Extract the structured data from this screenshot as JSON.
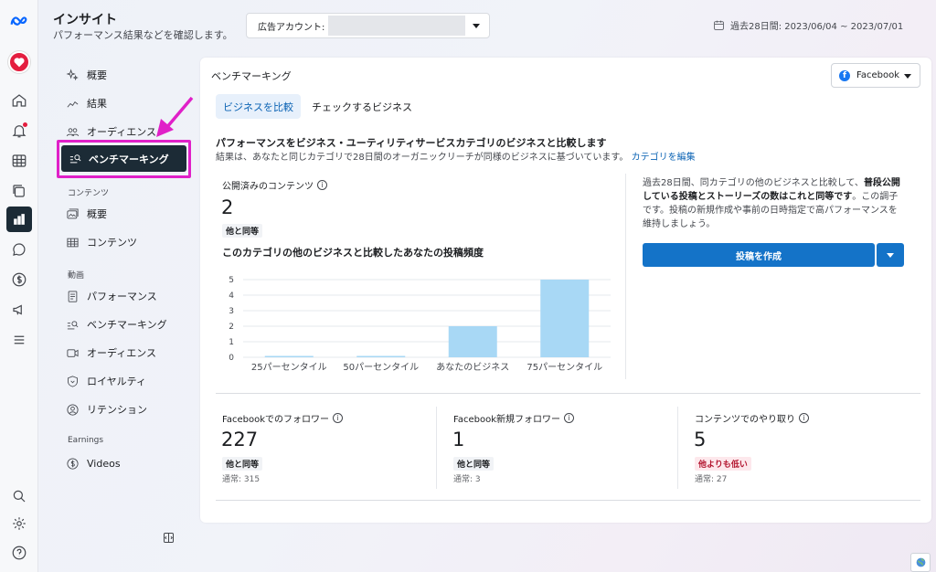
{
  "header": {
    "title": "インサイト",
    "subtitle": "パフォーマンス結果などを確認します。",
    "account_label": "広告アカウント:",
    "date_range": "過去28日間: 2023/06/04 ~ 2023/07/01"
  },
  "sidebar": {
    "items_top": [
      {
        "label": "概要",
        "icon": "sparkle-icon"
      },
      {
        "label": "結果",
        "icon": "trend-icon"
      },
      {
        "label": "オーディエンス",
        "icon": "people-icon"
      }
    ],
    "active": {
      "label": "ベンチマーキング",
      "icon": "benchmark-icon"
    },
    "section_contents": "コンテンツ",
    "items_contents": [
      {
        "label": "概要",
        "icon": "image-icon"
      },
      {
        "label": "コンテンツ",
        "icon": "table-icon"
      }
    ],
    "section_video": "動画",
    "items_video": [
      {
        "label": "パフォーマンス",
        "icon": "document-icon"
      },
      {
        "label": "ベンチマーキング",
        "icon": "benchmark-icon"
      },
      {
        "label": "オーディエンス",
        "icon": "video-icon"
      },
      {
        "label": "ロイヤルティ",
        "icon": "shield-icon"
      },
      {
        "label": "リテンション",
        "icon": "person-circle-icon"
      }
    ],
    "section_earnings": "Earnings",
    "items_earnings": [
      {
        "label": "Videos",
        "icon": "dollar-icon"
      }
    ]
  },
  "card": {
    "title": "ベンチマーキング",
    "platform": "Facebook",
    "tabs": [
      "ビジネスを比較",
      "チェックするビジネス"
    ],
    "heading": "パフォーマンスをビジネス・ユーティリティサービスカテゴリのビジネスと比較します",
    "subtext": "結果は、あなたと同じカテゴリで28日間のオーガニックリーチが同様のビジネスに基づいています。",
    "edit_link": "カテゴリを編集",
    "published": {
      "label": "公開済みのコンテンツ",
      "value": "2",
      "badge": "他と同等"
    },
    "chart_title": "このカテゴリの他のビジネスと比較したあなたの投稿頻度",
    "right_text_1": "過去28日間、同カテゴリの他のビジネスと比較して、",
    "right_text_bold": "普段公開している投稿とストーリーズの数はこれと同等です",
    "right_text_2": "。この調子です。投稿の新規作成や事前の日時指定で高パフォーマンスを維持しましょう。",
    "create_button": "投稿を作成"
  },
  "chart_data": {
    "type": "bar",
    "categories": [
      "25パーセンタイル",
      "50パーセンタイル",
      "あなたのビジネス",
      "75パーセンタイル"
    ],
    "values": [
      0,
      0,
      2,
      5
    ],
    "ylim": [
      0,
      5
    ],
    "yticks": [
      "0",
      "1",
      "2",
      "3",
      "4",
      "5"
    ],
    "grid": true,
    "bar_color": "#a8d8f5"
  },
  "metrics": [
    {
      "label": "Facebookでのフォロワー",
      "value": "227",
      "badge": "他と同等",
      "badge_type": "same",
      "usual": "通常: 315"
    },
    {
      "label": "Facebook新規フォロワー",
      "value": "1",
      "badge": "他と同等",
      "badge_type": "same",
      "usual": "通常: 3"
    },
    {
      "label": "コンテンツでのやり取り",
      "value": "5",
      "badge": "他よりも低い",
      "badge_type": "low",
      "usual": "通常: 27"
    }
  ]
}
